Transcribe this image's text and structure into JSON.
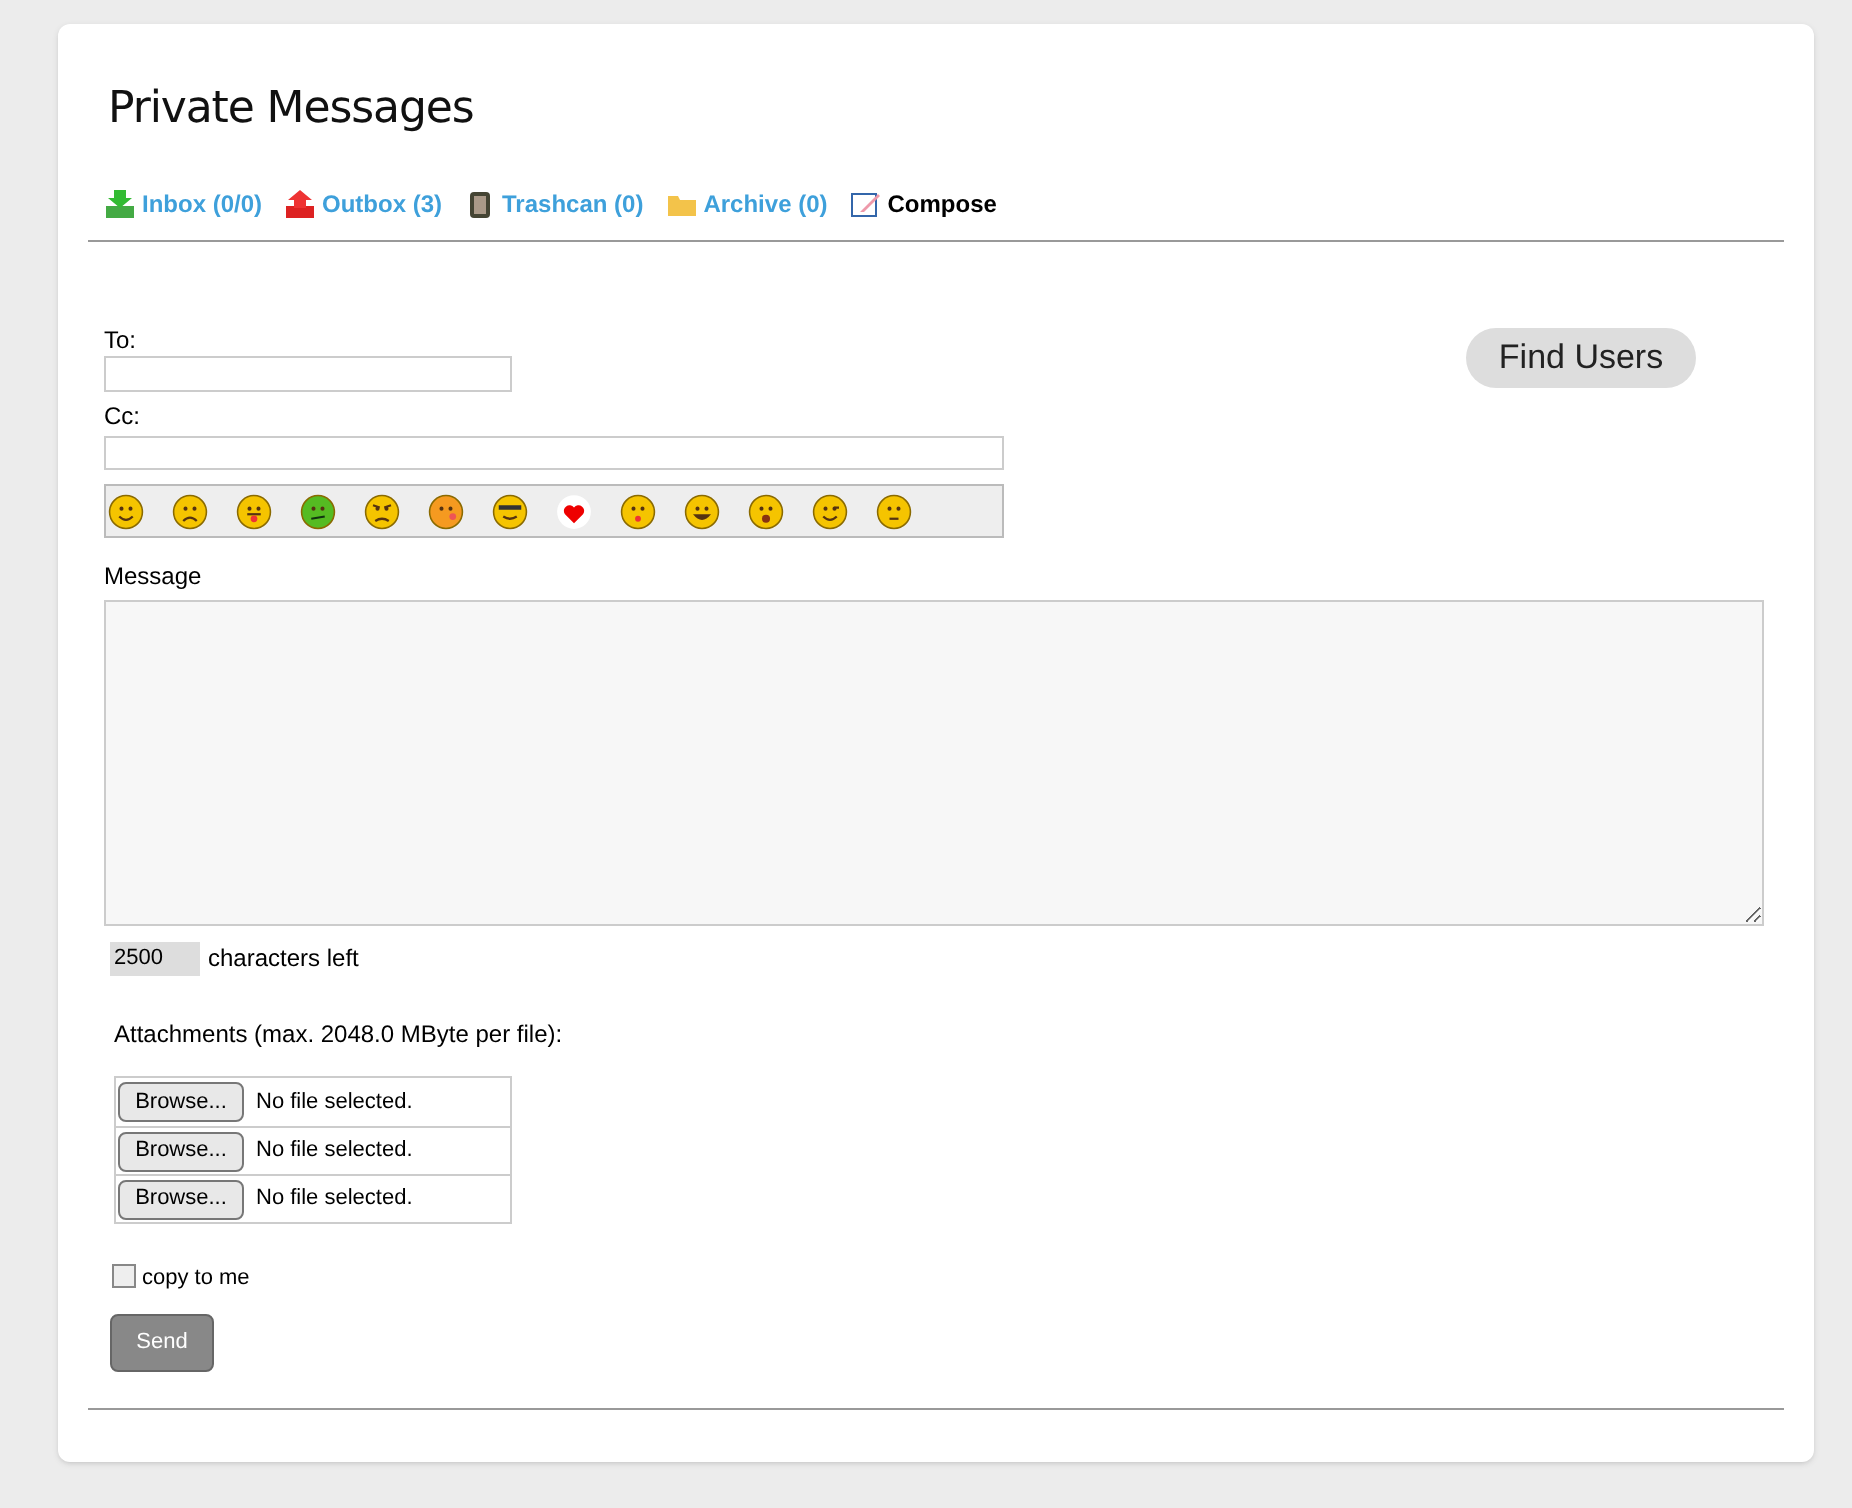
{
  "title": "Private Messages",
  "nav": [
    {
      "kind": "inbox",
      "label": "Inbox (0/0)",
      "selected": false
    },
    {
      "kind": "outbox",
      "label": "Outbox (3)",
      "selected": false
    },
    {
      "kind": "trash",
      "label": "Trashcan (0)",
      "selected": false
    },
    {
      "kind": "folder",
      "label": "Archive (0)",
      "selected": false
    },
    {
      "kind": "compose",
      "label": "Compose",
      "selected": true
    }
  ],
  "to_label": "To:",
  "cc_label": "Cc:",
  "find_users": "Find Users",
  "smileys": [
    {
      "kind": "smile"
    },
    {
      "kind": "sad"
    },
    {
      "kind": "tongue"
    },
    {
      "kind": "sick"
    },
    {
      "kind": "angry"
    },
    {
      "kind": "blush"
    },
    {
      "kind": "cool"
    },
    {
      "kind": "heart"
    },
    {
      "kind": "kiss"
    },
    {
      "kind": "grin"
    },
    {
      "kind": "surprised"
    },
    {
      "kind": "wink"
    },
    {
      "kind": "confused"
    }
  ],
  "message_label": "Message",
  "counter": {
    "value": "2500",
    "label": "characters left"
  },
  "attachments_label": "Attachments (max. 2048.0 MByte per file):",
  "files": [
    {
      "button": "Browse...",
      "status": "No file selected."
    },
    {
      "button": "Browse...",
      "status": "No file selected."
    },
    {
      "button": "Browse...",
      "status": "No file selected."
    }
  ],
  "copy_to_me": {
    "label": "copy to me",
    "checked": false
  },
  "send": "Send"
}
